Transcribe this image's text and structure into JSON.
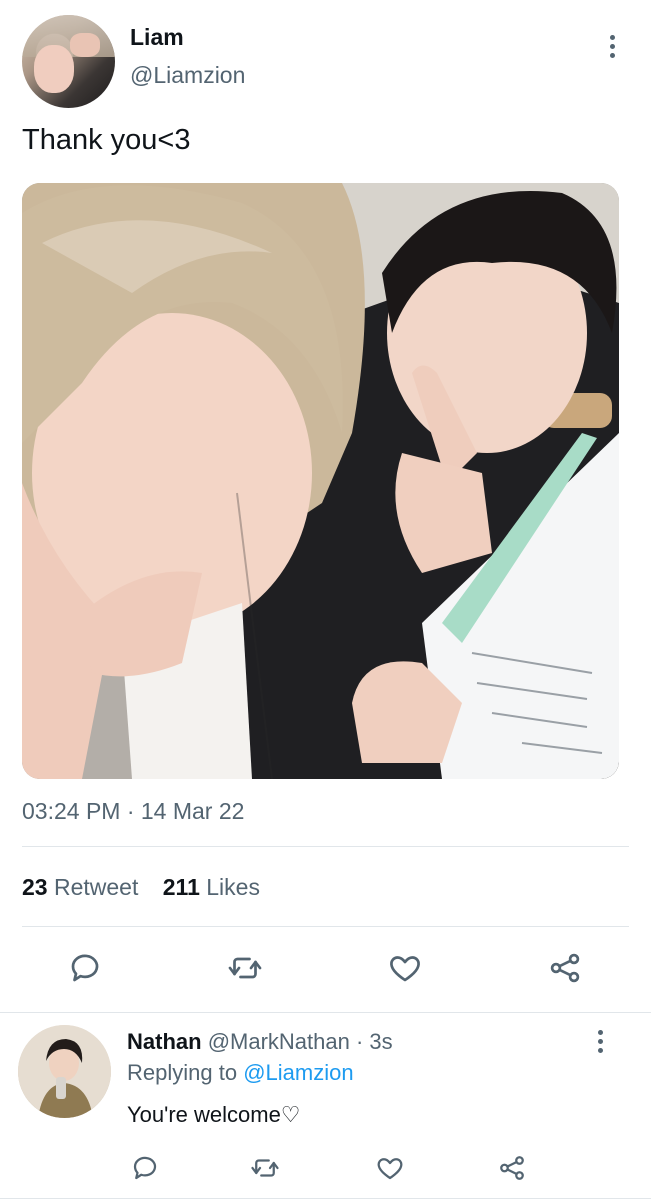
{
  "tweet": {
    "author_name": "Liam",
    "author_handle": "@Liamzion",
    "text": "Thank you<3",
    "timestamp": "03:24 PM · 14 Mar 22",
    "retweet_count": "23",
    "retweet_label": "Retweet",
    "like_count": "211",
    "like_label": "Likes"
  },
  "reply": {
    "author_name": "Nathan",
    "author_handle": "@MarkNathan",
    "time_ago": "· 3s",
    "replying_prefix": "Replying to",
    "replying_to": "@Liamzion",
    "text": "You're welcome♡"
  },
  "icons": {
    "actions": [
      "reply-icon",
      "retweet-icon",
      "like-icon",
      "share-icon"
    ],
    "menu": "more-vertical-icon"
  },
  "colors": {
    "text": "#0f1419",
    "secondary": "#536471",
    "accent": "#1d9bf0",
    "divider": "#e1e6ea"
  }
}
